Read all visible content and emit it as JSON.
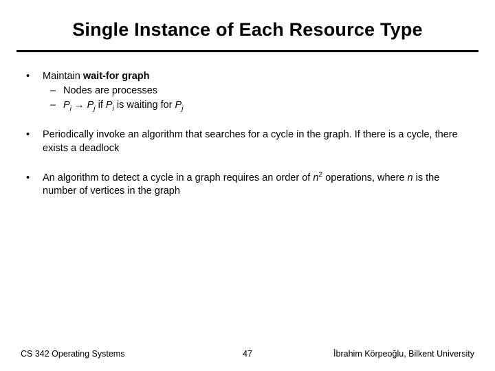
{
  "title": "Single Instance of Each Resource Type",
  "bullets": {
    "b0": {
      "lead": "Maintain ",
      "bold": "wait-for graph",
      "sub0": "Nodes are processes",
      "sub1_tail": " is waiting for "
    },
    "b1": "Periodically invoke an algorithm that searches for a cycle in the graph. If there is a cycle, there exists a deadlock",
    "b2_pre": "An algorithm to detect a cycle in a graph requires an order of ",
    "b2_post": " operations, where ",
    "b2_end": " is the number of vertices in the graph"
  },
  "sym": {
    "P": "P",
    "i": "i",
    "j": "j",
    "arrow": "→",
    "if": " if ",
    "n": "n",
    "two": "2"
  },
  "footer": {
    "left": "CS 342 Operating Systems",
    "page": "47",
    "right": "İbrahim Körpeoğlu, Bilkent University"
  },
  "marks": {
    "dot": "•",
    "dash": "–"
  }
}
